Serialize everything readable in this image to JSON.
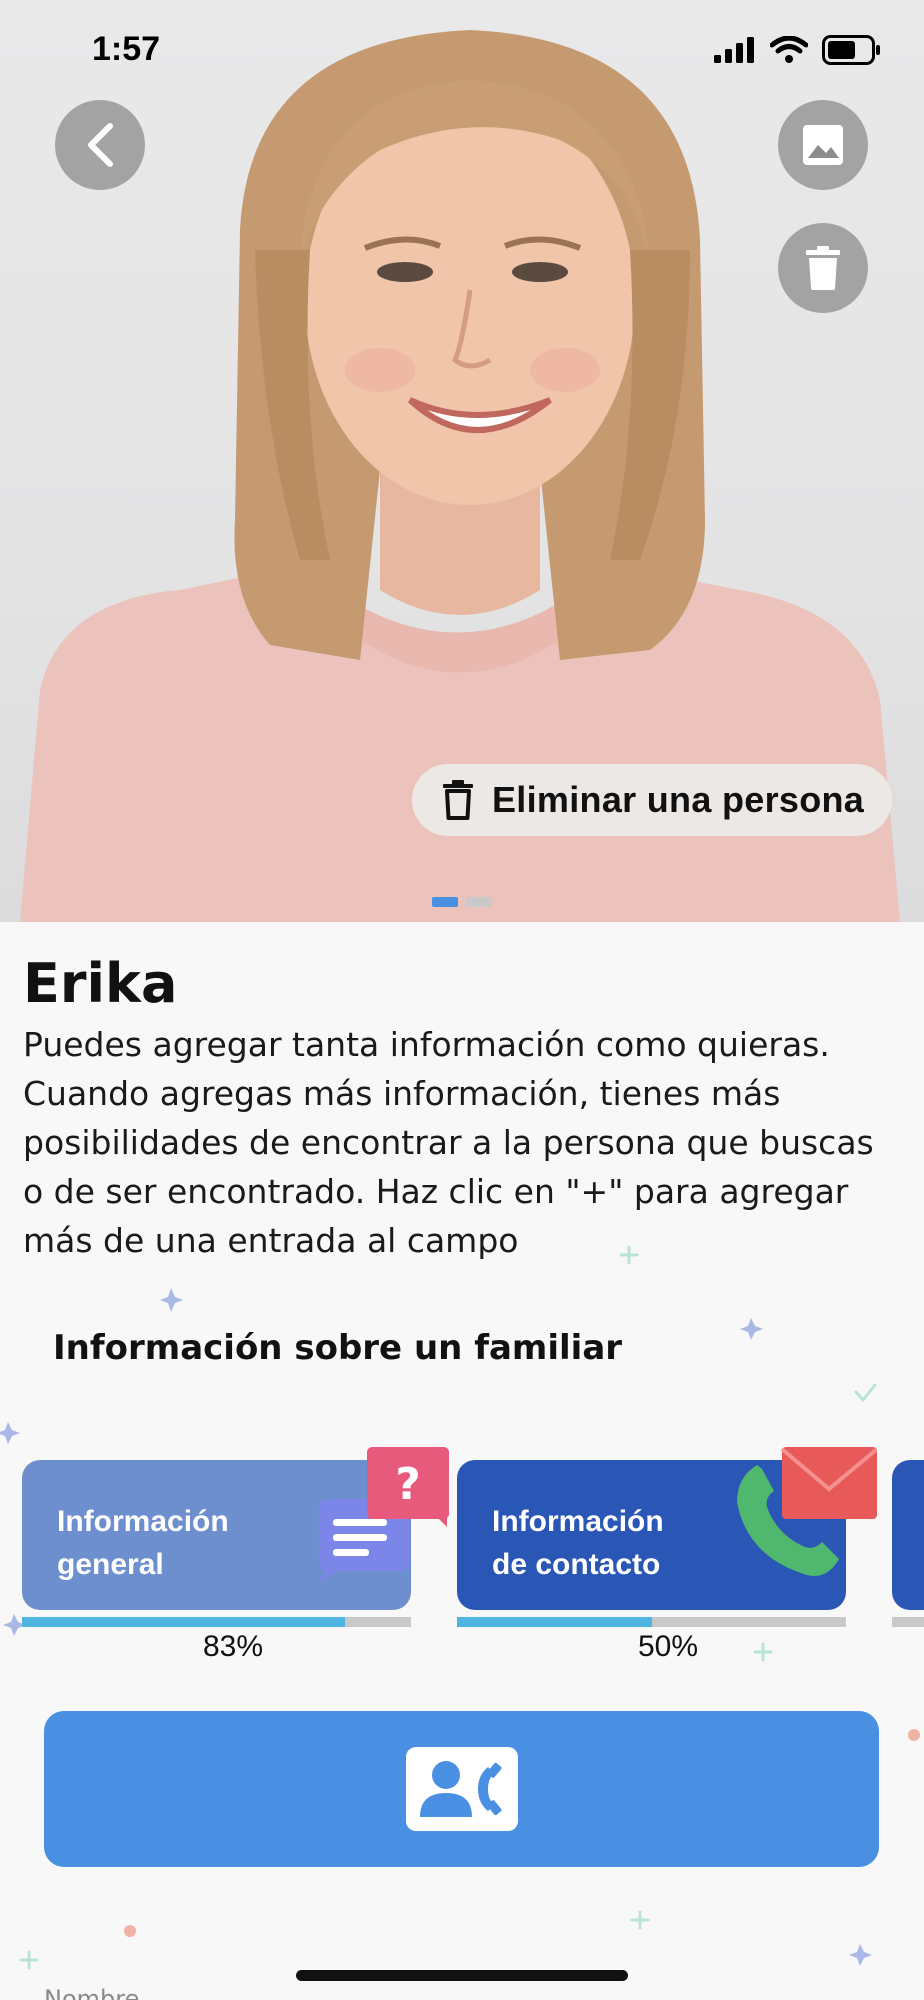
{
  "status_bar": {
    "time": "1:57"
  },
  "hero": {
    "delete_person_label": "Eliminar una persona",
    "pager": {
      "count": 2,
      "active_index": 0
    }
  },
  "profile": {
    "name": "Erika",
    "description": "Puedes agregar tanta información como quieras. Cuando agregas más información, tienes más posibilidades de encontrar a la persona que buscas o de ser encontrado. Haz clic en \"+\" para agregar más de una entrada al campo"
  },
  "section": {
    "title": "Información sobre un familiar"
  },
  "cards": [
    {
      "label_line1": "Información",
      "label_line2": "general",
      "progress": 0.83,
      "progress_text": "83%"
    },
    {
      "label_line1": "Información",
      "label_line2": "de contacto",
      "progress": 0.5,
      "progress_text": "50%"
    }
  ],
  "form": {
    "first_field_label": "Nombre"
  },
  "colors": {
    "accent": "#4a90e2",
    "progress_fill": "#4fb5e0",
    "card_general": "#6e8fce",
    "card_contact": "#2a56b5"
  },
  "icons": [
    "chevron-left-icon",
    "image-icon",
    "trash-icon",
    "contact-call-icon",
    "signal-icon",
    "wifi-icon",
    "battery-icon"
  ]
}
